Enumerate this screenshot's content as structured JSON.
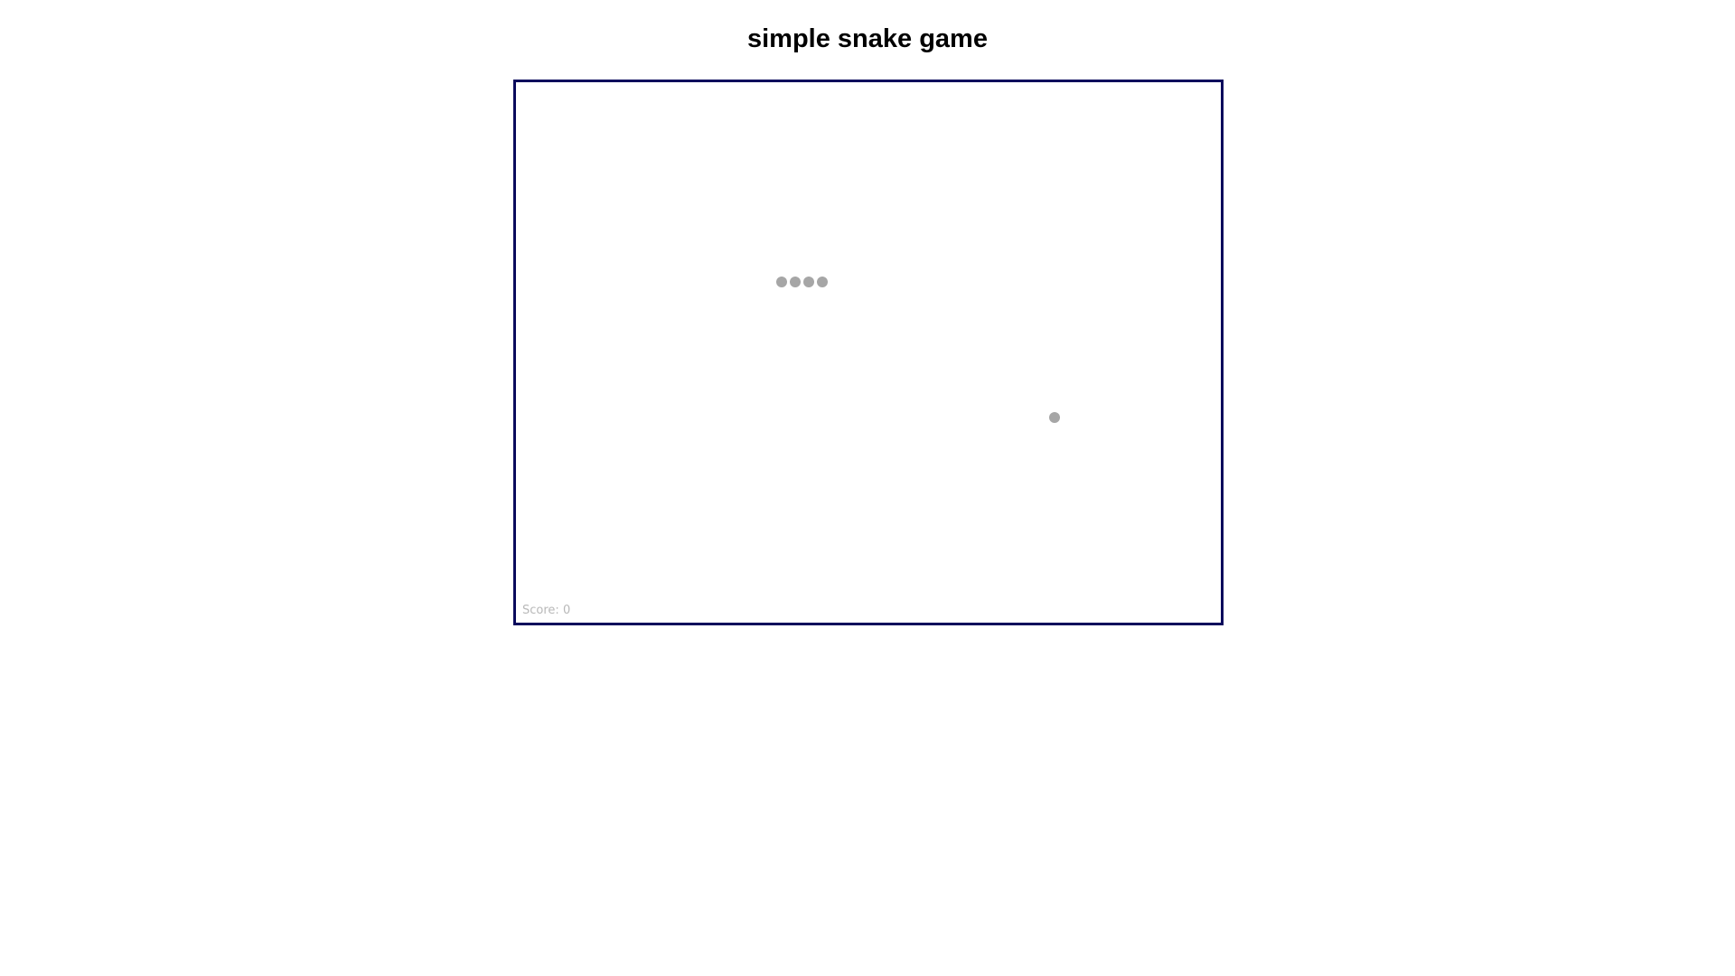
{
  "page": {
    "title": "simple snake game"
  },
  "game": {
    "score_label": "Score:",
    "score": 0,
    "snake_length": 4,
    "food_count": 1,
    "colors": {
      "border": "#0a0a5c",
      "piece": "#a6a6a6",
      "score_text": "#b8b8b8",
      "background": "#ffffff"
    }
  }
}
